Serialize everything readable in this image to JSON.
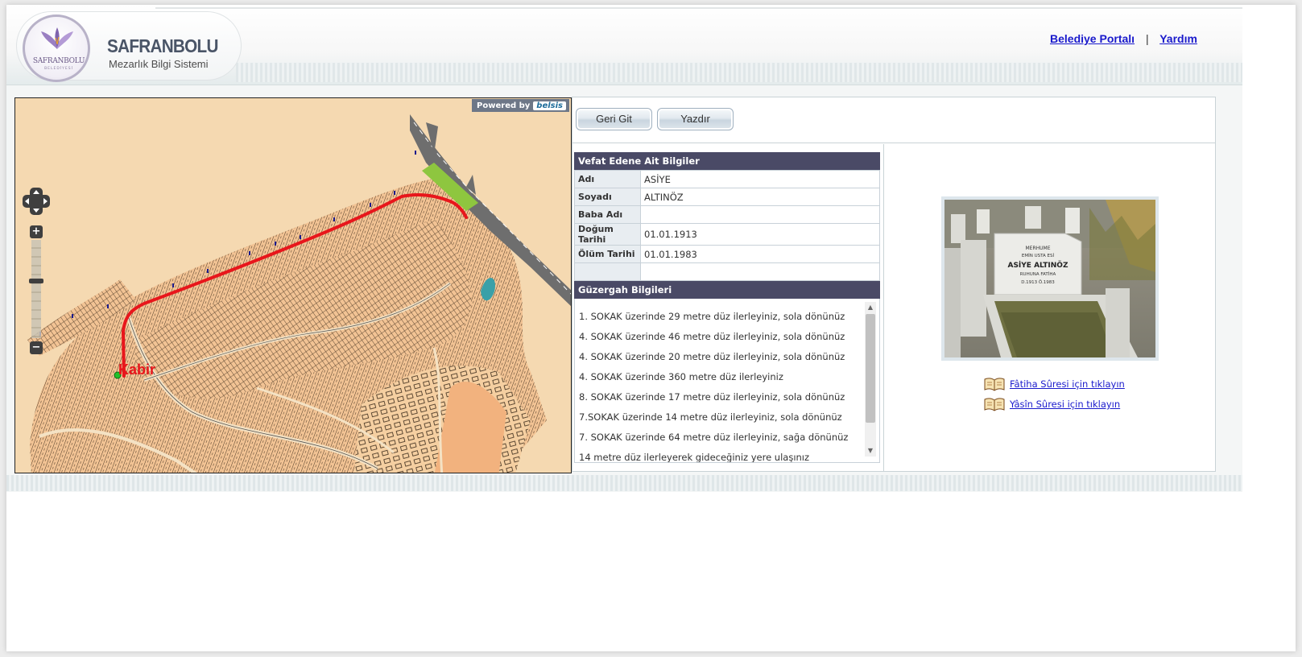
{
  "header": {
    "brand_title": "SAFRANBOLU",
    "brand_subtitle": "Mezarlık Bilgi Sistemi",
    "logo_text": "SAFRANBOLU",
    "logo_subtext": "BELEDİYESİ",
    "links": [
      {
        "label": "Belediye Portalı"
      },
      {
        "label": "Yardım"
      }
    ],
    "link_separator": "|"
  },
  "map": {
    "powered_by": "Powered by",
    "powered_brand": "belsis",
    "zoom_in": "+",
    "zoom_out": "−",
    "marker_label": "Kabir",
    "route_color": "#e8161b"
  },
  "toolbar": {
    "back_label": "Geri Git",
    "print_label": "Yazdır"
  },
  "deceased": {
    "section_title": "Vefat Edene Ait Bilgiler",
    "rows": [
      {
        "key": "Adı",
        "value": "ASİYE"
      },
      {
        "key": "Soyadı",
        "value": "ALTINÖZ"
      },
      {
        "key": "Baba Adı",
        "value": ""
      },
      {
        "key": "Doğum Tarihi",
        "value": "01.01.1913"
      },
      {
        "key": "Ölüm Tarihi",
        "value": "01.01.1983"
      },
      {
        "key": "",
        "value": ""
      }
    ]
  },
  "route": {
    "section_title": "Güzergah Bilgileri",
    "steps": [
      "1. SOKAK üzerinde 29 metre düz ilerleyiniz, sola dönünüz",
      "4. SOKAK üzerinde 46 metre düz ilerleyiniz, sola dönünüz",
      "4. SOKAK üzerinde 20 metre düz ilerleyiniz, sola dönünüz",
      "4. SOKAK üzerinde 360 metre düz ilerleyiniz",
      "8. SOKAK üzerinde 17 metre düz ilerleyiniz, sola dönünüz",
      "7.SOKAK üzerinde 14 metre düz ilerleyiniz, sola dönünüz",
      "7. SOKAK üzerinde 64 metre düz ilerleyiniz, sağa dönünüz",
      "14 metre düz ilerleyerek gideceğiniz yere ulaşınız"
    ]
  },
  "photo": {
    "gravestone_lines": [
      "MERHUME",
      "EMİN USTA ESİ",
      "ASİYE ALTINÖZ",
      "RUHUNA FATİHA",
      "D.1913  Ö.1983"
    ]
  },
  "prayers": [
    {
      "label": "Fâtiha Sûresi için tıklayın"
    },
    {
      "label": "Yâsîn Sûresi için tıklayın"
    }
  ]
}
